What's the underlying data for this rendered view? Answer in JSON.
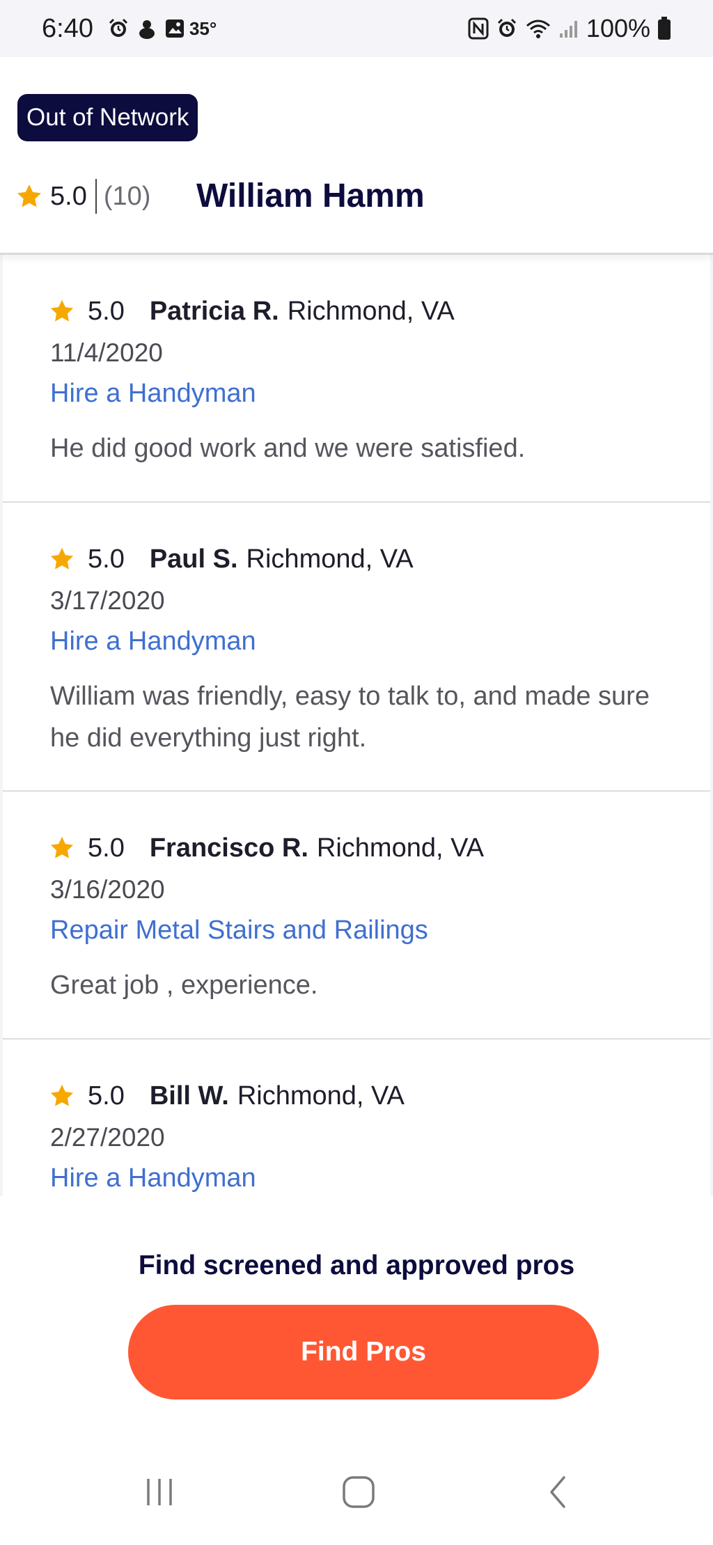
{
  "status_bar": {
    "time": "6:40",
    "temperature": "35°",
    "battery": "100%",
    "icons_left": [
      "alarm-icon",
      "accuweather-icon",
      "gallery-icon"
    ],
    "icons_right": [
      "nfc-icon",
      "alarm-icon",
      "wifi-icon",
      "signal-icon",
      "battery-icon"
    ]
  },
  "header": {
    "badge": "Out of Network",
    "rating": "5.0",
    "review_count": "(10)",
    "pro_name": "William Hamm"
  },
  "reviews": [
    {
      "rating": "5.0",
      "name": "Patricia R.",
      "location": "Richmond, VA",
      "date": "11/4/2020",
      "service": "Hire a Handyman",
      "text": "He did good work and we were satisfied."
    },
    {
      "rating": "5.0",
      "name": "Paul S.",
      "location": "Richmond, VA",
      "date": "3/17/2020",
      "service": "Hire a Handyman",
      "text": "William was friendly, easy to talk to, and made sure he did everything just right."
    },
    {
      "rating": "5.0",
      "name": "Francisco R.",
      "location": "Richmond, VA",
      "date": "3/16/2020",
      "service": "Repair Metal Stairs and Railings",
      "text": "Great job , experience."
    },
    {
      "rating": "5.0",
      "name": "Bill W.",
      "location": "Richmond, VA",
      "date": "2/27/2020",
      "service": "Hire a Handyman",
      "text": ""
    }
  ],
  "footer": {
    "title": "Find screened and approved pros",
    "button_label": "Find Pros"
  },
  "colors": {
    "brand_navy": "#0d0c3e",
    "accent_orange": "#ff5733",
    "link_blue": "#3f6fd0",
    "star_gold": "#f7a800"
  },
  "navigation": [
    "recent-apps-icon",
    "home-icon",
    "back-icon"
  ]
}
